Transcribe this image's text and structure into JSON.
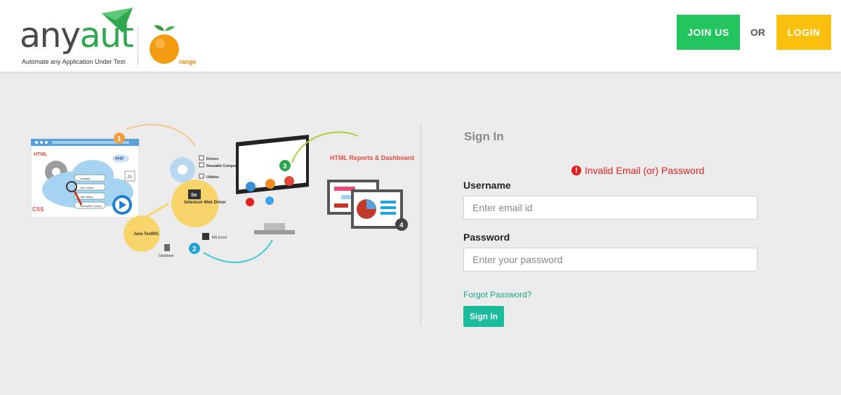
{
  "header": {
    "logo_any": "any",
    "logo_aut": "aut",
    "logo_tagline": "Automate any Application Under Test",
    "partner_logo_text": "range",
    "join_label": "JOIN US",
    "or_label": "OR",
    "login_label": "LOGIN"
  },
  "illustration": {
    "step_numbers": [
      "1",
      "2",
      "3",
      "4"
    ],
    "labels": {
      "html": "HTML",
      "css": "CSS",
      "php": "PHP",
      "js": "JS",
      "list_items": [
        "Variable",
        "Test Cases",
        "Test Steps",
        "Reusable Comps"
      ],
      "drivers": "Drivers",
      "reusable_components": "Reusable Components",
      "utilities": "Utilities",
      "selenium": "Selenium Web Driver",
      "java_testng": "Java TestNG",
      "database": "Database",
      "excel": "MS Excel",
      "reports": "HTML Reports & Dashboards"
    }
  },
  "signin": {
    "title": "Sign In",
    "error": "Invalid Email (or) Password",
    "username_label": "Username",
    "username_placeholder": "Enter email id",
    "username_value": "",
    "password_label": "Password",
    "password_placeholder": "Enter your password",
    "password_value": "",
    "forgot_label": "Forgot Password?",
    "submit_label": "Sign In"
  },
  "colors": {
    "brand_green": "#2fa84f",
    "join_bg": "#22c55e",
    "login_bg": "#fbbf0e",
    "error": "#e02020",
    "accent_teal": "#1abc9c"
  }
}
